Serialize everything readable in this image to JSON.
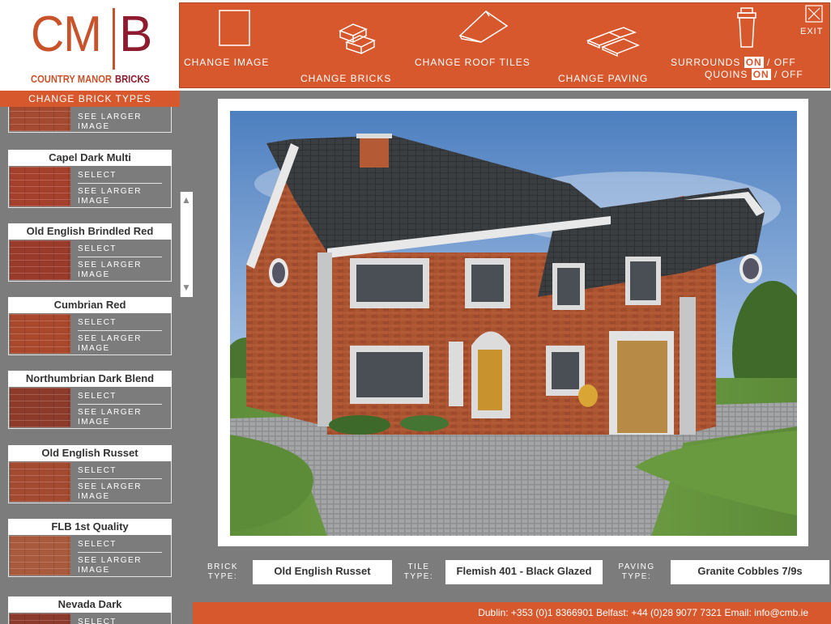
{
  "logo": {
    "cm": "CM",
    "b": "B",
    "sub1": "COUNTRY MANOR",
    "sub2": "BRICKS"
  },
  "toolbar": {
    "change_image": "CHANGE IMAGE",
    "change_bricks": "CHANGE BRICKS",
    "change_roof_tiles": "CHANGE ROOF TILES",
    "change_paving": "CHANGE PAVING",
    "surrounds_label": "SURROUNDS",
    "quoins_label": "QUOINS",
    "on": "ON",
    "off": "/ OFF",
    "exit": "EXIT"
  },
  "left": {
    "header": "CHANGE BRICK TYPES",
    "select": "SELECT",
    "larger": "SEE LARGER IMAGE",
    "bricks": [
      {
        "name": "Capel Dark Multi",
        "color": "#a4402c"
      },
      {
        "name": "Old English Brindled Red",
        "color": "#9a3a2a"
      },
      {
        "name": "Cumbrian Red",
        "color": "#a9482c"
      },
      {
        "name": "Northumbrian Dark Blend",
        "color": "#8e3a2a"
      },
      {
        "name": "Old English Russet",
        "color": "#a44a30"
      },
      {
        "name": "FLB 1st Quality",
        "color": "#a95a3c"
      },
      {
        "name": "Nevada Dark",
        "color": "#8c3a2c"
      }
    ]
  },
  "selection": {
    "brick_label": "BRICK TYPE:",
    "brick_value": "Old English Russet",
    "tile_label": "TILE TYPE:",
    "tile_value": "Flemish 401 - Black Glazed",
    "paving_label": "PAVING TYPE:",
    "paving_value": "Granite Cobbles 7/9s"
  },
  "footer": {
    "contact": "Dublin: +353 (0)1 8366901 Belfast:  +44 (0)28 9077 7321  Email: info@cmb.ie"
  },
  "colors": {
    "accent": "#d8582e",
    "maroon": "#8e1b2e",
    "panel": "#7c7c7c"
  }
}
